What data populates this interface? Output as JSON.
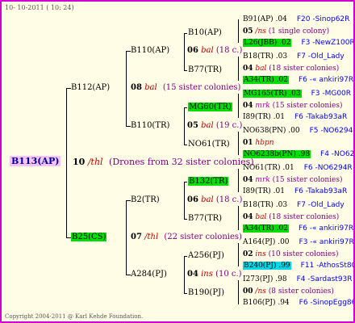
{
  "header": {
    "date_text": "10- 10-2011 ( 10: 24)"
  },
  "footer": {
    "copyright": "Copyright 2004-2011 @ Karl Kehde Foundation."
  },
  "colors": {
    "border": "#d000d0",
    "background": "#fffde6",
    "green": "#00e000",
    "cyan": "#00d8e8",
    "root_bg": "#f4c4f4"
  },
  "tree": {
    "root": {
      "label": "B113(AP)"
    },
    "root_breed": {
      "year": "10",
      "name": "/thl",
      "note": "(Drones from 32 sister colonies)"
    },
    "parents": {
      "upper": {
        "label": "B112(AP)",
        "breed": {
          "year": "08",
          "name": "bal",
          "note": "(15 sister colonies)"
        },
        "children": {
          "a": {
            "label": "B110(AP)",
            "breed": {
              "year": "06",
              "name": "bal",
              "note": "(18 c.)"
            }
          },
          "b": {
            "label": "B110(TR)",
            "breed": {
              "year": "05",
              "name": "bal",
              "note": "(19 c.)"
            }
          }
        },
        "grand": {
          "g1": {
            "label": "B10(AP)",
            "breed": {
              "year": "05",
              "name": "/ns",
              "note": "(1 single colony)"
            }
          },
          "g2": {
            "label": "B77(TR)",
            "breed": {
              "year": "04",
              "name": "bal",
              "note": "(18 sister colonies)"
            }
          },
          "g3": {
            "label": "MG60(TR)",
            "breed": {
              "year": "04",
              "name": "mrk",
              "note": "(15 sister colonies)"
            }
          },
          "g4": {
            "label": "NO61(TR)",
            "breed": {
              "year": "01",
              "name": "hbpn",
              "note": ""
            }
          }
        }
      },
      "lower": {
        "label": "B25(CS)",
        "breed": {
          "year": "07",
          "name": "/thl",
          "note": "(22 sister colonies)"
        },
        "children": {
          "a": {
            "label": "B2(TR)",
            "breed": {
              "year": "06",
              "name": "bal",
              "note": "(18 c.)"
            }
          },
          "b": {
            "label": "A284(PJ)",
            "breed": {
              "year": "04",
              "name": "ins",
              "note": "(10 c.)"
            }
          }
        },
        "grand": {
          "g1": {
            "label": "B132(TR)",
            "breed": {
              "year": "04",
              "name": "mrk",
              "note": "(15 sister colonies)"
            }
          },
          "g2": {
            "label": "B77(TR)",
            "breed": {
              "year": "04",
              "name": "bal",
              "note": "(18 sister colonies)"
            }
          },
          "g3": {
            "label": "A256(PJ)",
            "breed": {
              "year": "02",
              "name": "ins",
              "note": "(10 sister colonies)"
            }
          },
          "g4": {
            "label": "B190(PJ)",
            "breed": {
              "year": "00",
              "name": "/ns",
              "note": "(8 sister colonies)"
            }
          }
        }
      }
    },
    "leaves": [
      {
        "left": "B91(AP) .04",
        "right": "F20 -Sinop62R"
      },
      {
        "left": "L26(JBB) .02",
        "right": "F3 -NewZ100R"
      },
      {
        "left": "B18(TR) .03",
        "right": "F7 -Old_Lady"
      },
      {
        "left": "A34(TR) .02",
        "right": "F6 -« ankiri97R"
      },
      {
        "left": "MG165(TR) .03",
        "right": "F3 -MG00R"
      },
      {
        "left": "I89(TR) .01",
        "right": "F6 -Takab93aR"
      },
      {
        "left": "NO638(PN) .00",
        "right": "F5 -NO6294R"
      },
      {
        "left": "NO6238b(PN) .98",
        "right": "F4 -NO6294R"
      },
      {
        "left": "NO61(TR) .01",
        "right": "F6 -NO6294R"
      },
      {
        "left": "I89(TR) .01",
        "right": "F6 -Takab93aR"
      },
      {
        "left": "B18(TR) .03",
        "right": "F7 -Old_Lady"
      },
      {
        "left": "A34(TR) .02",
        "right": "F6 -« ankiri97R"
      },
      {
        "left": "A164(PJ) .00",
        "right": "F3 -« ankiri97R"
      },
      {
        "left": "B240(PJ) .99",
        "right": "F11 -AthosSt80R"
      },
      {
        "left": "I273(PJ) .98",
        "right": "F4 -Sardast93R"
      },
      {
        "left": "B106(PJ) .94",
        "right": "F6 -SinopEgg86R"
      }
    ]
  }
}
